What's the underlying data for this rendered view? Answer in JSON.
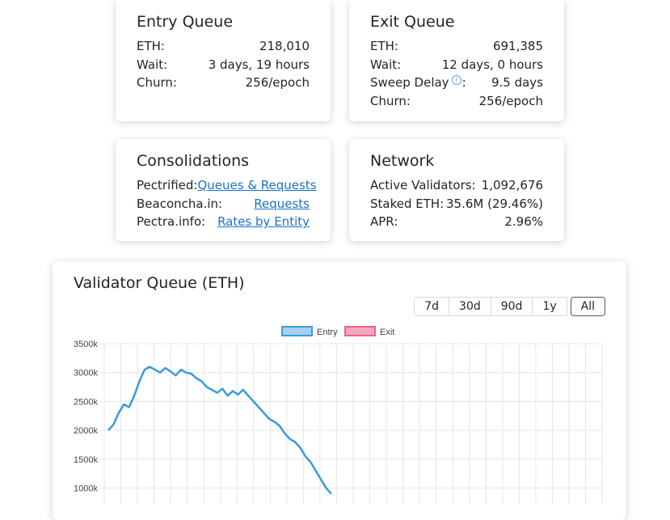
{
  "entry_queue": {
    "title": "Entry Queue",
    "rows": [
      {
        "label": "ETH:",
        "value": "218,010"
      },
      {
        "label": "Wait:",
        "value": "3 days, 19 hours"
      },
      {
        "label": "Churn:",
        "value": "256/epoch"
      }
    ]
  },
  "exit_queue": {
    "title": "Exit Queue",
    "rows": [
      {
        "label": "ETH:",
        "value": "691,385"
      },
      {
        "label": "Wait:",
        "value": "12 days, 0 hours"
      },
      {
        "label": "Sweep Delay",
        "suffix": ":",
        "value": "9.5 days"
      },
      {
        "label": "Churn:",
        "value": "256/epoch"
      }
    ],
    "info_icon_glyph": "i"
  },
  "consolidations": {
    "title": "Consolidations",
    "rows": [
      {
        "label": "Pectrified:",
        "link": "Queues & Requests"
      },
      {
        "label": "Beaconcha.in:",
        "link": "Requests"
      },
      {
        "label": "Pectra.info:",
        "link": "Rates by Entity"
      }
    ],
    "link_color": "#1a73c8"
  },
  "network": {
    "title": "Network",
    "rows": [
      {
        "label": "Active Validators:",
        "value": "1,092,676"
      },
      {
        "label": "Staked ETH:",
        "value": "35.6M (29.46%)"
      },
      {
        "label": "APR:",
        "value": "2.96%"
      }
    ]
  },
  "chart_section": {
    "title": "Validator Queue (ETH)",
    "ranges": [
      "7d",
      "30d",
      "90d",
      "1y",
      "All"
    ],
    "selected_range": "All"
  },
  "chart_data": {
    "type": "line",
    "title": "",
    "xlabel": "",
    "ylabel": "",
    "legend_position": "top",
    "grid": true,
    "y_tick_labels": [
      "3500k",
      "3000k",
      "2500k",
      "2000k",
      "1500k",
      "1000k"
    ],
    "y_ticks": [
      3500,
      3000,
      2500,
      2000,
      1500,
      1000
    ],
    "ylim": [
      1000,
      3500
    ],
    "x_points": 97,
    "series": [
      {
        "name": "Entry",
        "color": "#3b9ad9",
        "fill": "#a6cff0",
        "values": [
          2000,
          2100,
          2300,
          2450,
          2400,
          2600,
          2850,
          3050,
          3100,
          3050,
          3000,
          3080,
          3020,
          2950,
          3050,
          3000,
          2980,
          2900,
          2850,
          2750,
          2700,
          2650,
          2720,
          2600,
          2680,
          2620,
          2700,
          2600,
          2500,
          2400,
          2300,
          2200,
          2150,
          2080,
          1950,
          1850,
          1800,
          1700,
          1550,
          1450,
          1300,
          1150,
          1000,
          900
        ]
      },
      {
        "name": "Exit",
        "color": "#e8638c",
        "fill": "#f4a6bd",
        "values": []
      }
    ]
  }
}
